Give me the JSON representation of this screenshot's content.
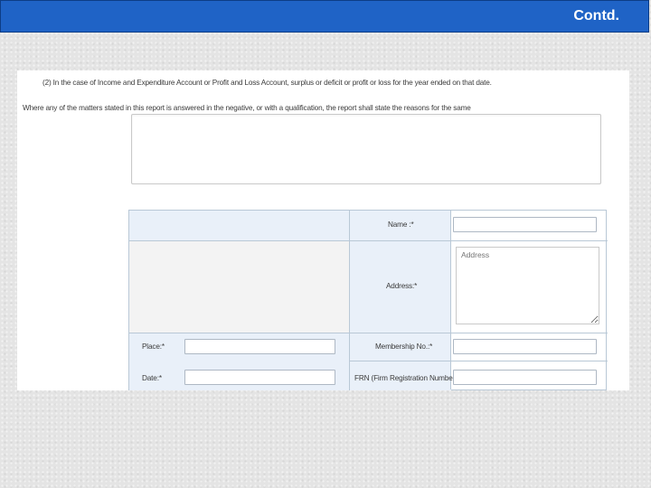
{
  "slide": {
    "title": "Contd."
  },
  "form": {
    "line1": "(2)   In the case of Income and Expenditure Account or Profit and Loss Account, surplus or deficit or profit or loss for the year ended on that date.",
    "line2": "Where any of the matters stated in this report is answered in the negative, or with a qualification, the report shall state the reasons for the same",
    "reasons_value": "",
    "fields": {
      "name_label": "Name :*",
      "address_label": "Address:*",
      "address_placeholder": "Address",
      "place_label": "Place:*",
      "date_label": "Date:*",
      "membership_label": "Membership No.:*",
      "frn_label": "FRN (Firm Registration Number):"
    }
  }
}
